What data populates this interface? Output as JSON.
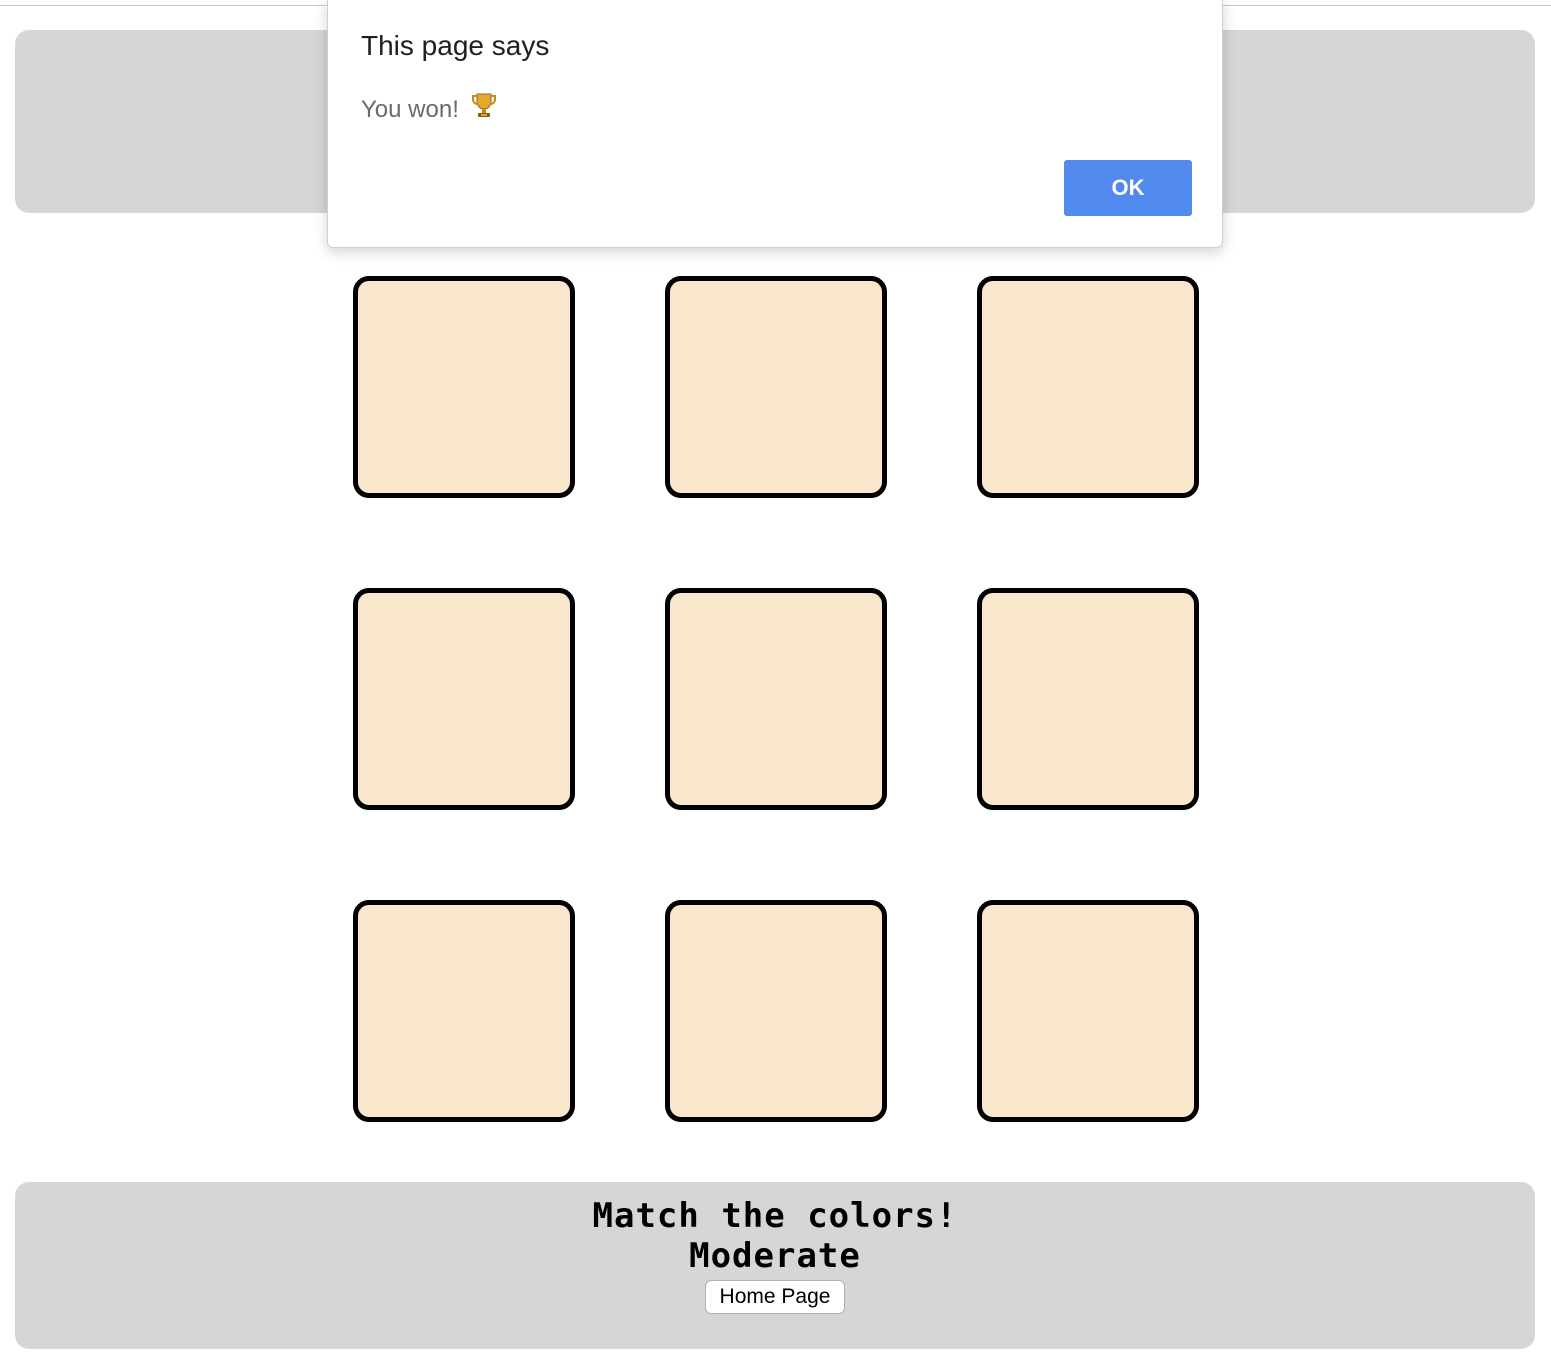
{
  "dialog": {
    "title": "This page says",
    "message": "You won!",
    "icon": "trophy-icon",
    "ok_label": "OK",
    "accent_color": "#5189ee"
  },
  "board": {
    "rows": 3,
    "columns": 3,
    "tile_color": "#fae8cd",
    "tile_border_color": "#000000",
    "tiles": [
      {
        "row": 1,
        "column": 1,
        "color": "#fae8cd"
      },
      {
        "row": 1,
        "column": 2,
        "color": "#fae8cd"
      },
      {
        "row": 1,
        "column": 3,
        "color": "#fae8cd"
      },
      {
        "row": 2,
        "column": 1,
        "color": "#fae8cd"
      },
      {
        "row": 2,
        "column": 2,
        "color": "#fae8cd"
      },
      {
        "row": 2,
        "column": 3,
        "color": "#fae8cd"
      },
      {
        "row": 3,
        "column": 1,
        "color": "#fae8cd"
      },
      {
        "row": 3,
        "column": 2,
        "color": "#fae8cd"
      },
      {
        "row": 3,
        "column": 3,
        "color": "#fae8cd"
      }
    ]
  },
  "footer": {
    "title": "Match the colors!",
    "level": "Moderate",
    "home_button_label": "Home Page"
  },
  "panel_color": "#d6d6d6"
}
